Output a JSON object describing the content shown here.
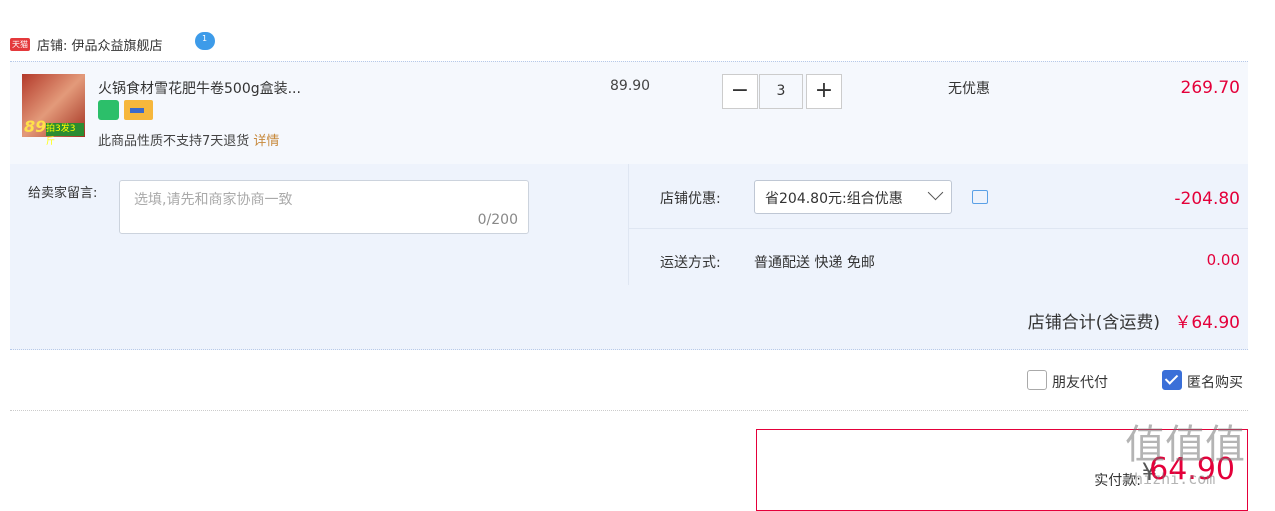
{
  "shop": {
    "badge": "天猫",
    "name": "店铺: 伊品众益旗舰店",
    "chat_badge": "1"
  },
  "item": {
    "thumb_price": "89",
    "thumb_tag": "拍3发3斤",
    "title": "火锅食材雪花肥牛卷500g盒装...",
    "no_return": "此商品性质不支持7天退货",
    "details_link": "详情",
    "unit_price": "89.90",
    "quantity": "3",
    "qty_minus": "−",
    "qty_plus": "+",
    "discount": "无优惠",
    "subtotal": "269.70"
  },
  "message": {
    "label": "给卖家留言:",
    "placeholder": "选填,请先和商家协商一致",
    "count": "0/200"
  },
  "promo": {
    "label": "店铺优惠:",
    "selected": "省204.80元:组合优惠",
    "amount": "-204.80"
  },
  "shipping": {
    "label": "运送方式:",
    "value": "普通配送 快递 免邮",
    "cost": "0.00"
  },
  "total": {
    "label": "店铺合计(含运费)",
    "value": "￥64.90"
  },
  "options": {
    "friend_pay": "朋友代付",
    "anonymous": "匿名购买"
  },
  "payment": {
    "label": "实付款:",
    "yen": "¥",
    "value": "64.90"
  },
  "watermark": {
    "text": "值值值",
    "site": "zhizhi.com"
  },
  "colors": {
    "accent_red": "#e4003a",
    "panel": "#eef3fc",
    "checkbox_blue": "#3a6fd8"
  }
}
